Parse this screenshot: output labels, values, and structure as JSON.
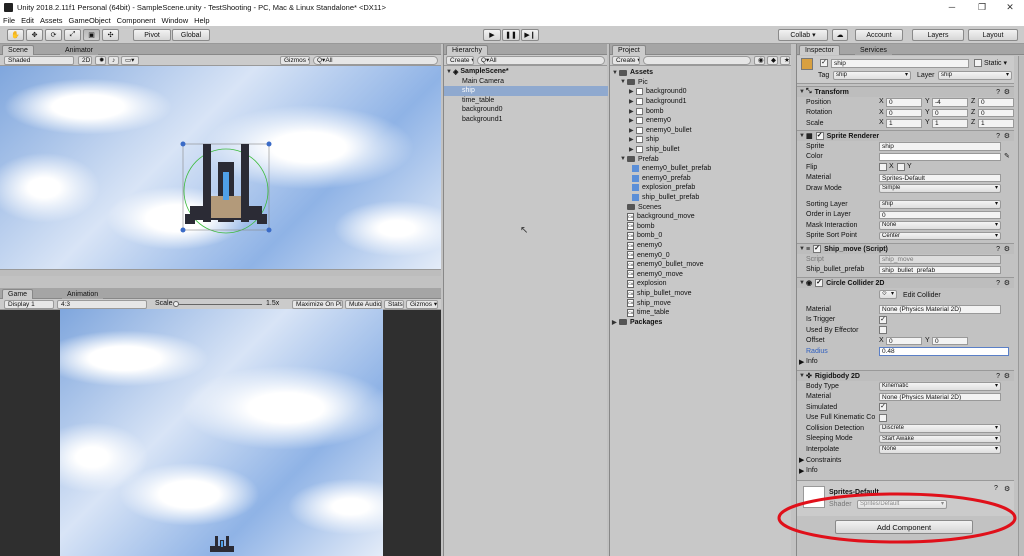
{
  "window": {
    "title": "Unity 2018.2.11f1 Personal (64bit) - SampleScene.unity - TestShooting - PC, Mac & Linux Standalone* <DX11>"
  },
  "menu": [
    "File",
    "Edit",
    "Assets",
    "GameObject",
    "Component",
    "Window",
    "Help"
  ],
  "toolbar": {
    "pivot": "Pivot",
    "global": "Global",
    "collab": "Collab ▾",
    "account": "Account",
    "layers": "Layers",
    "layout": "Layout"
  },
  "scene": {
    "tab": "Scene",
    "tab2": "Animator",
    "shading": "Shaded",
    "mode2d": "2D",
    "gizmos": "Gizmos ▾",
    "search": "Q▾All"
  },
  "game": {
    "tab": "Game",
    "tab2": "Animation",
    "display": "Display 1",
    "aspect": "4:3",
    "scale_label": "Scale",
    "scale_value": "1.5x",
    "maximize": "Maximize On Play",
    "mute": "Mute Audio",
    "stats": "Stats",
    "gizmos": "Gizmos ▾"
  },
  "hierarchy": {
    "tab": "Hierarchy",
    "create": "Create ▾",
    "search": "Q▾All",
    "scene": "SampleScene*",
    "items": [
      "Main Camera",
      "ship",
      "time_table",
      "background0",
      "background1"
    ]
  },
  "project": {
    "tab": "Project",
    "create": "Create ▾",
    "assets": "Assets",
    "pic": "Pic",
    "pic_items": [
      "background0",
      "background1",
      "bomb",
      "enemy0",
      "enemy0_bullet",
      "ship",
      "ship_bullet"
    ],
    "prefab": "Prefab",
    "prefab_items": [
      "enemy0_bullet_prefab",
      "enemy0_prefab",
      "explosion_prefab",
      "ship_bullet_prefab"
    ],
    "scenes": "Scenes",
    "scripts": [
      "background_move",
      "bomb",
      "bomb_0",
      "enemy0",
      "enemy0_0",
      "enemy0_bullet_move",
      "enemy0_move",
      "explosion",
      "ship_bullet_move",
      "ship_move",
      "time_table"
    ],
    "packages": "Packages"
  },
  "inspector": {
    "tab": "Inspector",
    "tab2": "Services",
    "name": "ship",
    "static": "Static ▾",
    "tag_label": "Tag",
    "tag": "ship",
    "layer_label": "Layer",
    "layer": "ship",
    "transform": {
      "title": "Transform",
      "position": "Position",
      "rotation": "Rotation",
      "scale": "Scale",
      "pos": [
        "0",
        "-4",
        "0"
      ],
      "rot": [
        "0",
        "0",
        "0"
      ],
      "scl": [
        "1",
        "1",
        "1"
      ]
    },
    "sprite_renderer": {
      "title": "Sprite Renderer",
      "sprite_l": "Sprite",
      "sprite": "ship",
      "color_l": "Color",
      "flip_l": "Flip",
      "flip_x": "X",
      "flip_y": "Y",
      "material_l": "Material",
      "material": "Sprites-Default",
      "draw_mode_l": "Draw Mode",
      "draw_mode": "Simple",
      "sorting_layer_l": "Sorting Layer",
      "sorting_layer": "ship",
      "order_l": "Order in Layer",
      "order": "0",
      "mask_l": "Mask Interaction",
      "mask": "None",
      "sort_point_l": "Sprite Sort Point",
      "sort_point": "Center"
    },
    "ship_move": {
      "title": "Ship_move (Script)",
      "script_l": "Script",
      "script": "ship_move",
      "bullet_l": "Ship_bullet_prefab",
      "bullet": "ship_bullet_prefab"
    },
    "circle_collider": {
      "title": "Circle Collider 2D",
      "edit": "Edit Collider",
      "material_l": "Material",
      "material": "None (Physics Material 2D)",
      "trigger_l": "Is Trigger",
      "effector_l": "Used By Effector",
      "offset_l": "Offset",
      "offset": [
        "0",
        "0"
      ],
      "radius_l": "Radius",
      "radius": "0.48",
      "info": "Info"
    },
    "rigidbody": {
      "title": "Rigidbody 2D",
      "body_l": "Body Type",
      "body": "Kinematic",
      "material_l": "Material",
      "material": "None (Physics Material 2D)",
      "simulated_l": "Simulated",
      "full_kin_l": "Use Full Kinematic Co",
      "collision_l": "Collision Detection",
      "collision": "Discrete",
      "sleep_l": "Sleeping Mode",
      "sleep": "Start Awake",
      "interp_l": "Interpolate",
      "interp": "None",
      "constraints": "Constraints",
      "info": "Info"
    },
    "material_box": {
      "name": "Sprites-Default",
      "shader_l": "Shader",
      "shader": "Sprites/Default"
    },
    "add_component": "Add Component"
  },
  "colors": {
    "annotation": "#e0101a",
    "selection": "#8fa9cf",
    "panel": "#c2c2c2"
  }
}
